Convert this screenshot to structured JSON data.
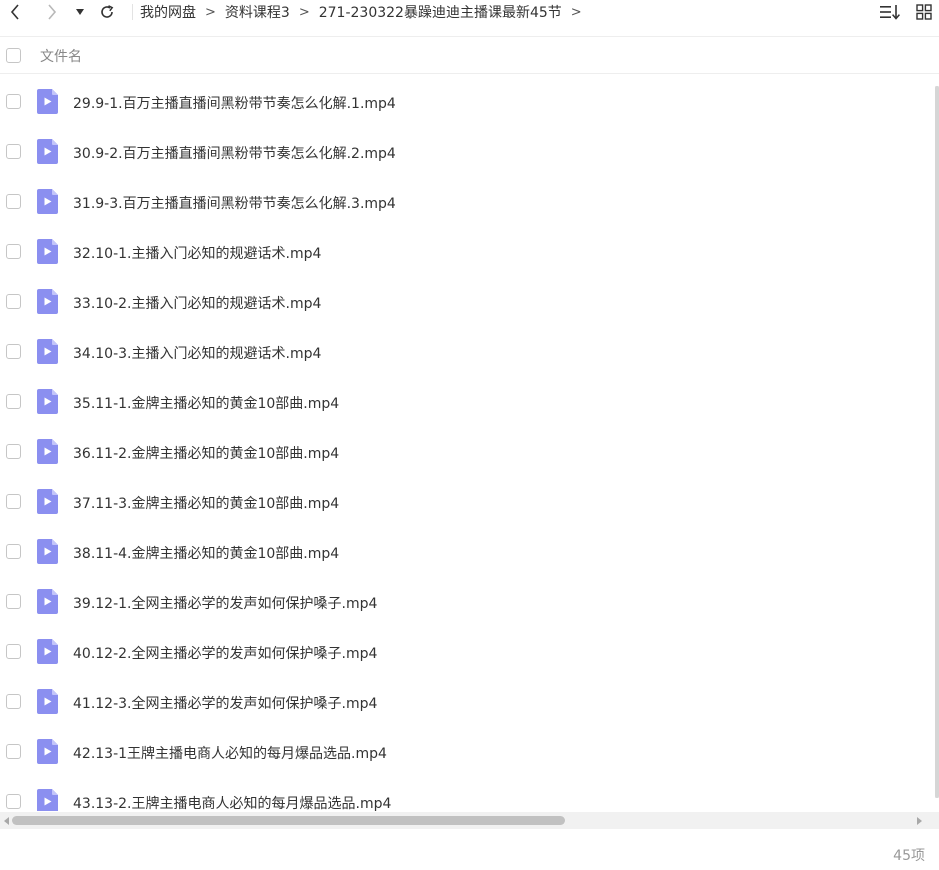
{
  "toolbar": {
    "back_icon": "chevron-left-icon",
    "forward_icon": "chevron-right-icon",
    "dropdown_icon": "caret-down-icon",
    "refresh_icon": "refresh-icon",
    "breadcrumb": [
      "我的网盘",
      "资料课程3",
      "271-230322暴躁迪迪主播课最新45节"
    ],
    "crumb_separator": ">",
    "sort_icon": "sort-list-icon",
    "view_icon": "grid-view-icon"
  },
  "header": {
    "name_column": "文件名"
  },
  "files": [
    {
      "name": "29.9-1.百万主播直播间黑粉带节奏怎么化解.1.mp4"
    },
    {
      "name": "30.9-2.百万主播直播间黑粉带节奏怎么化解.2.mp4"
    },
    {
      "name": "31.9-3.百万主播直播间黑粉带节奏怎么化解.3.mp4"
    },
    {
      "name": "32.10-1.主播入门必知的规避话术.mp4"
    },
    {
      "name": "33.10-2.主播入门必知的规避话术.mp4"
    },
    {
      "name": "34.10-3.主播入门必知的规避话术.mp4"
    },
    {
      "name": "35.11-1.金牌主播必知的黄金10部曲.mp4"
    },
    {
      "name": "36.11-2.金牌主播必知的黄金10部曲.mp4"
    },
    {
      "name": "37.11-3.金牌主播必知的黄金10部曲.mp4"
    },
    {
      "name": "38.11-4.金牌主播必知的黄金10部曲.mp4"
    },
    {
      "name": "39.12-1.全网主播必学的发声如何保护嗓子.mp4"
    },
    {
      "name": "40.12-2.全网主播必学的发声如何保护嗓子.mp4"
    },
    {
      "name": "41.12-3.全网主播必学的发声如何保护嗓子.mp4"
    },
    {
      "name": "42.13-1王牌主播电商人必知的每月爆品选品.mp4"
    },
    {
      "name": "43.13-2.王牌主播电商人必知的每月爆品选品.mp4"
    }
  ],
  "file_icon": "video-file-icon",
  "colors": {
    "file_icon": "#8b8ff0",
    "file_icon_fold": "#c3c5fa"
  },
  "footer": {
    "item_count": "45项"
  }
}
